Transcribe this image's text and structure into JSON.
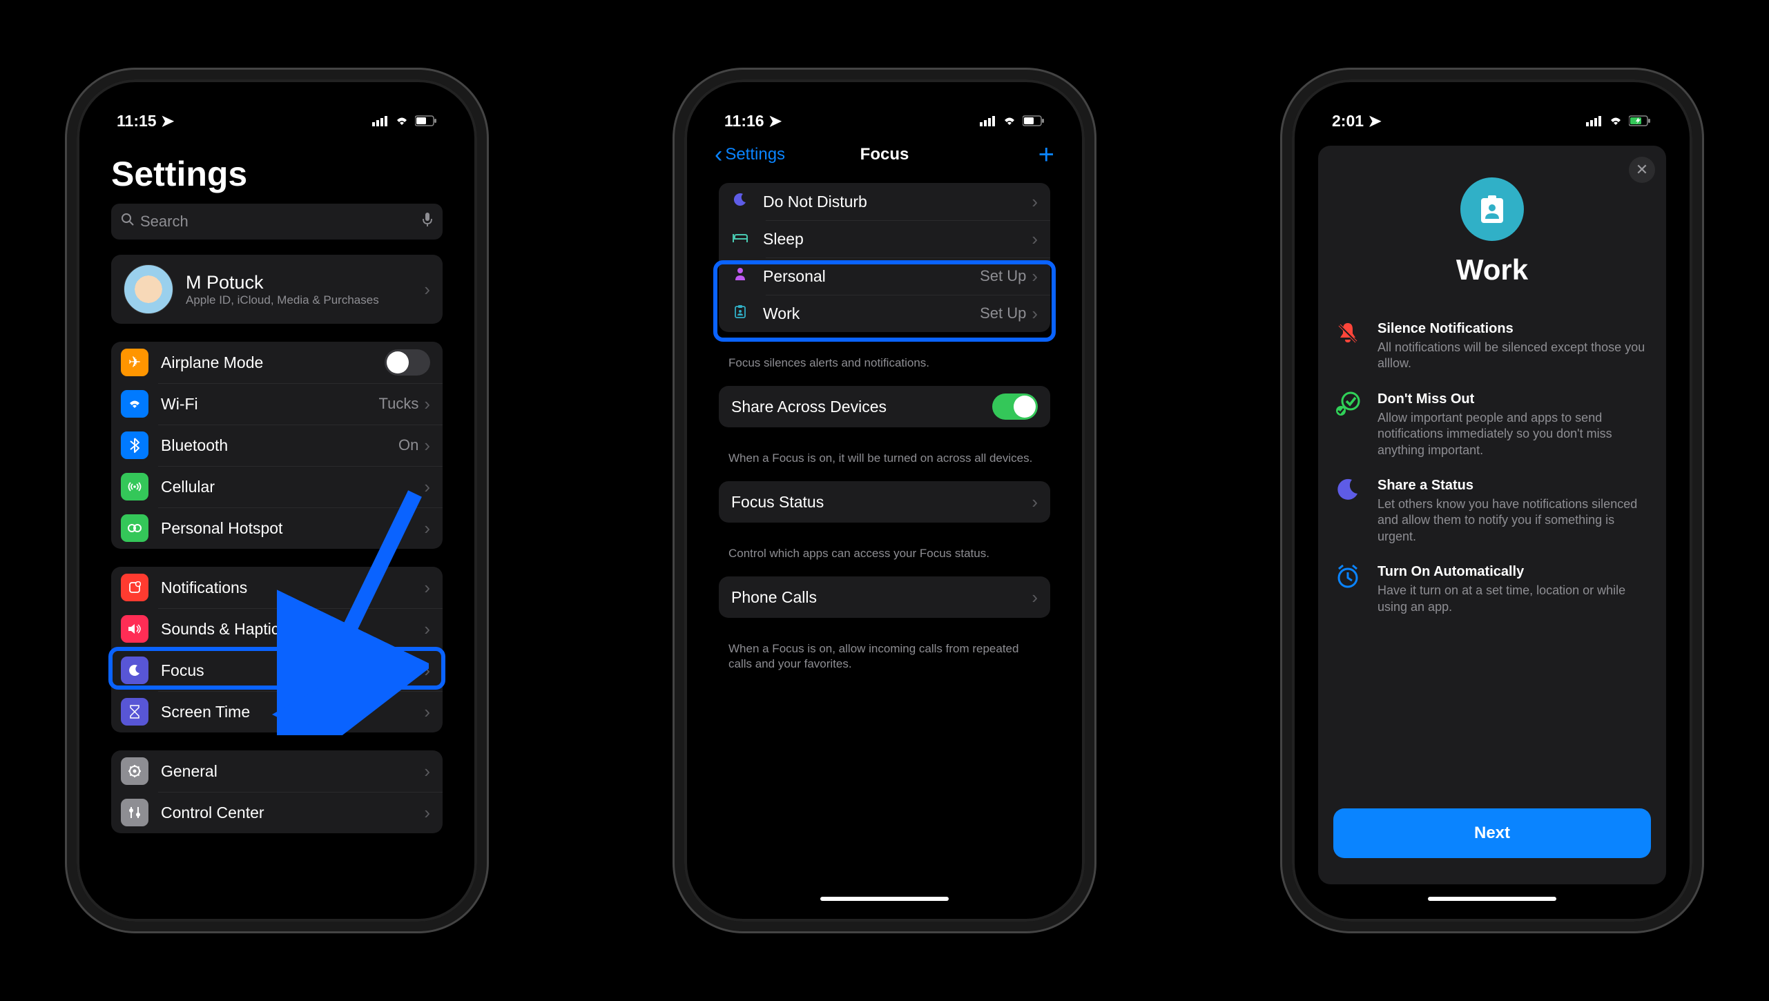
{
  "phone1": {
    "time": "11:15",
    "title": "Settings",
    "search_placeholder": "Search",
    "profile": {
      "name": "M Potuck",
      "sub": "Apple ID, iCloud, Media & Purchases"
    },
    "g1": {
      "airplane": "Airplane Mode",
      "wifi": "Wi-Fi",
      "wifi_val": "Tucks",
      "bt": "Bluetooth",
      "bt_val": "On",
      "cell": "Cellular",
      "hotspot": "Personal Hotspot"
    },
    "g2": {
      "notif": "Notifications",
      "sounds": "Sounds & Haptics",
      "focus": "Focus",
      "screentime": "Screen Time"
    },
    "g3": {
      "general": "General",
      "controlcenter": "Control Center"
    }
  },
  "phone2": {
    "time": "11:16",
    "back": "Settings",
    "title": "Focus",
    "modes": {
      "dnd": "Do Not Disturb",
      "sleep": "Sleep",
      "personal": "Personal",
      "personal_action": "Set Up",
      "work": "Work",
      "work_action": "Set Up"
    },
    "modes_footer": "Focus silences alerts and notifications.",
    "share_label": "Share Across Devices",
    "share_footer": "When a Focus is on, it will be turned on across all devices.",
    "status_label": "Focus Status",
    "status_footer": "Control which apps can access your Focus status.",
    "calls_label": "Phone Calls",
    "calls_footer": "When a Focus is on, allow incoming calls from repeated calls and your favorites."
  },
  "phone3": {
    "time": "2:01",
    "title": "Work",
    "f1": {
      "h": "Silence Notifications",
      "b": "All notifications will be silenced except those you alllow."
    },
    "f2": {
      "h": "Don't Miss Out",
      "b": "Allow important people and apps to send notifications immediately so you don't miss anything important."
    },
    "f3": {
      "h": "Share a Status",
      "b": "Let others know you have notifications silenced and allow them to notify you if something is urgent."
    },
    "f4": {
      "h": "Turn On Automatically",
      "b": "Have it turn on at a set time, location or while using an app."
    },
    "next": "Next"
  }
}
